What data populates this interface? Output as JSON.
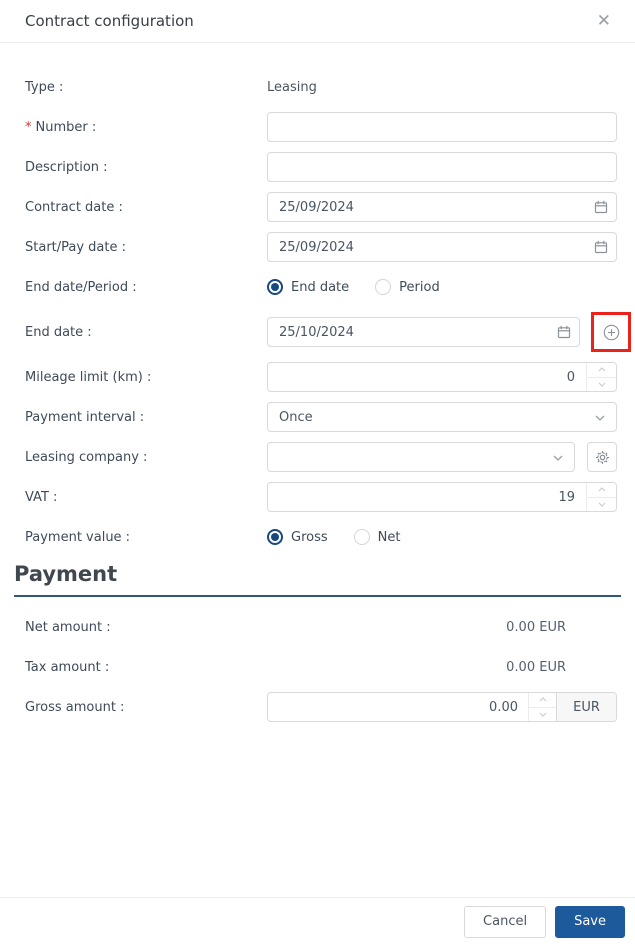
{
  "modal": {
    "title": "Contract configuration",
    "close_glyph": "✕"
  },
  "form": {
    "type": {
      "label": "Type :",
      "value": "Leasing"
    },
    "number": {
      "label": "Number :",
      "required_mark": "*",
      "value": ""
    },
    "description": {
      "label": "Description :",
      "value": ""
    },
    "contract_date": {
      "label": "Contract date :",
      "value": "25/09/2024"
    },
    "start_pay_date": {
      "label": "Start/Pay date :",
      "value": "25/09/2024"
    },
    "end_date_period": {
      "label": "End date/Period :",
      "options": [
        {
          "label": "End date",
          "selected": true
        },
        {
          "label": "Period",
          "selected": false
        }
      ]
    },
    "end_date": {
      "label": "End date :",
      "value": "25/10/2024"
    },
    "mileage_limit": {
      "label": "Mileage limit (km) :",
      "value": "0"
    },
    "payment_interval": {
      "label": "Payment interval :",
      "value": "Once"
    },
    "leasing_company": {
      "label": "Leasing company :",
      "value": ""
    },
    "vat": {
      "label": "VAT :",
      "value": "19"
    },
    "payment_value": {
      "label": "Payment value :",
      "options": [
        {
          "label": "Gross",
          "selected": true
        },
        {
          "label": "Net",
          "selected": false
        }
      ]
    }
  },
  "payment_section": {
    "heading": "Payment",
    "net_amount": {
      "label": "Net amount :",
      "value": "0.00 EUR"
    },
    "tax_amount": {
      "label": "Tax amount :",
      "value": "0.00 EUR"
    },
    "gross_amount": {
      "label": "Gross amount :",
      "value": "0.00",
      "currency": "EUR"
    }
  },
  "footer": {
    "cancel_label": "Cancel",
    "save_label": "Save"
  },
  "colors": {
    "accent": "#1d5a9b",
    "radio_selected": "#17497f",
    "highlight_box": "#e8231a",
    "heading_underline": "#33567d"
  }
}
